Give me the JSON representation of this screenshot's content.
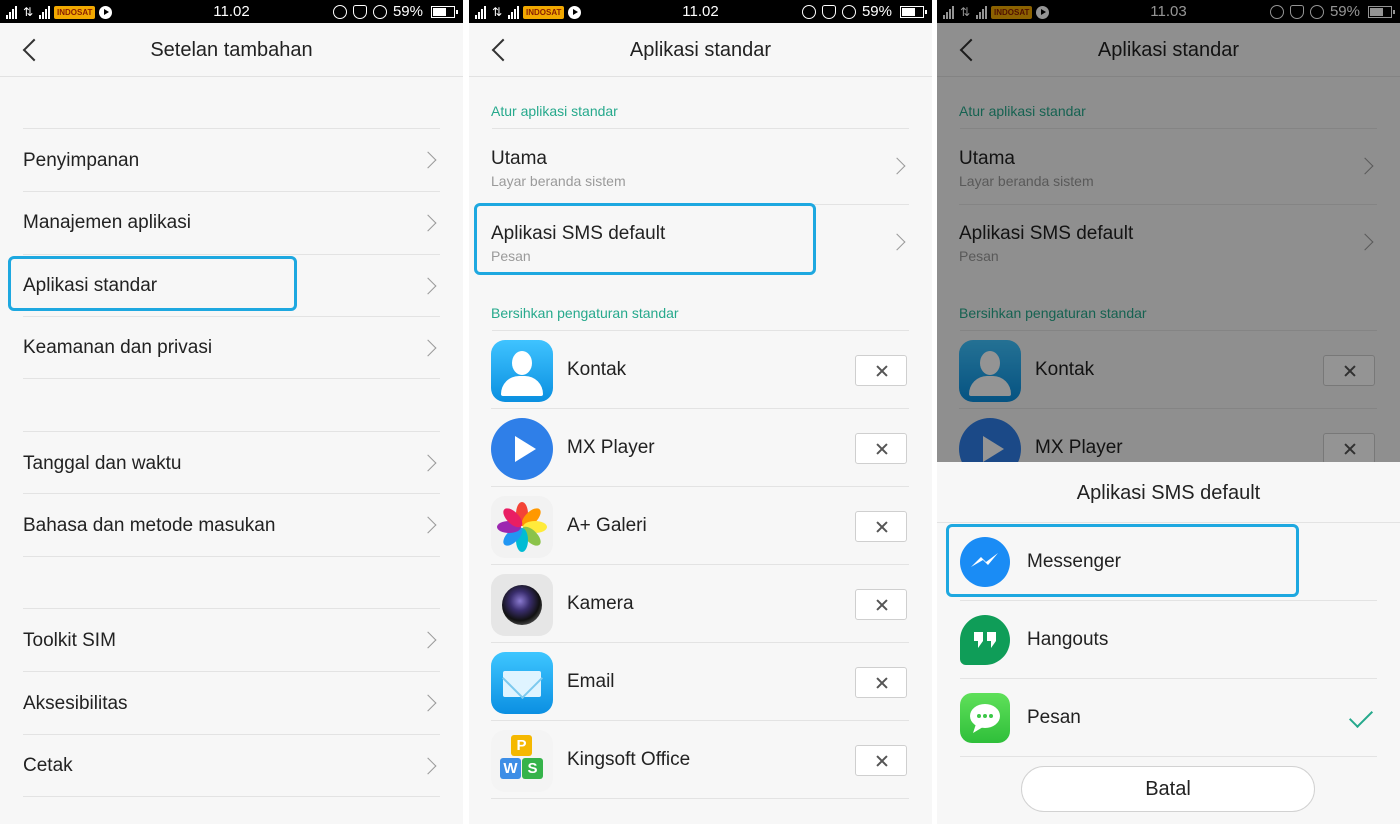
{
  "status_bar": {
    "battery": "59%",
    "badge": "INDOSAT",
    "panels_time": [
      "11.02",
      "11.02",
      "11.03"
    ]
  },
  "panel1": {
    "title": "Setelan tambahan",
    "items": [
      {
        "label": "Penyimpanan"
      },
      {
        "label": "Manajemen aplikasi"
      },
      {
        "label": "Aplikasi standar",
        "highlighted": true
      },
      {
        "label": "Keamanan dan privasi"
      },
      {
        "label": "Tanggal dan waktu"
      },
      {
        "label": "Bahasa dan metode masukan"
      },
      {
        "label": "Toolkit SIM"
      },
      {
        "label": "Aksesibilitas"
      },
      {
        "label": "Cetak"
      }
    ]
  },
  "panel2": {
    "title": "Aplikasi standar",
    "section_set": "Atur aplikasi standar",
    "defaults": [
      {
        "label": "Utama",
        "sub": "Layar beranda sistem"
      },
      {
        "label": "Aplikasi SMS default",
        "sub": "Pesan",
        "highlighted": true
      }
    ],
    "section_clear": "Bersihkan pengaturan standar",
    "apps": [
      {
        "name": "Kontak",
        "icon": "contacts-icon"
      },
      {
        "name": "MX Player",
        "icon": "mx-player-icon"
      },
      {
        "name": "A+ Galeri",
        "icon": "gallery-icon"
      },
      {
        "name": "Kamera",
        "icon": "camera-icon"
      },
      {
        "name": "Email",
        "icon": "email-icon"
      },
      {
        "name": "Kingsoft Office",
        "icon": "kingsoft-office-icon"
      }
    ]
  },
  "panel3": {
    "title": "Aplikasi standar",
    "sheet_title": "Aplikasi SMS default",
    "options": [
      {
        "name": "Messenger",
        "icon": "messenger-icon",
        "highlighted": true
      },
      {
        "name": "Hangouts",
        "icon": "hangouts-icon"
      },
      {
        "name": "Pesan",
        "icon": "messages-icon",
        "selected": true
      }
    ],
    "cancel_label": "Batal"
  },
  "colors": {
    "accent": "#26a98c",
    "highlight_border": "#1ea8e0"
  }
}
